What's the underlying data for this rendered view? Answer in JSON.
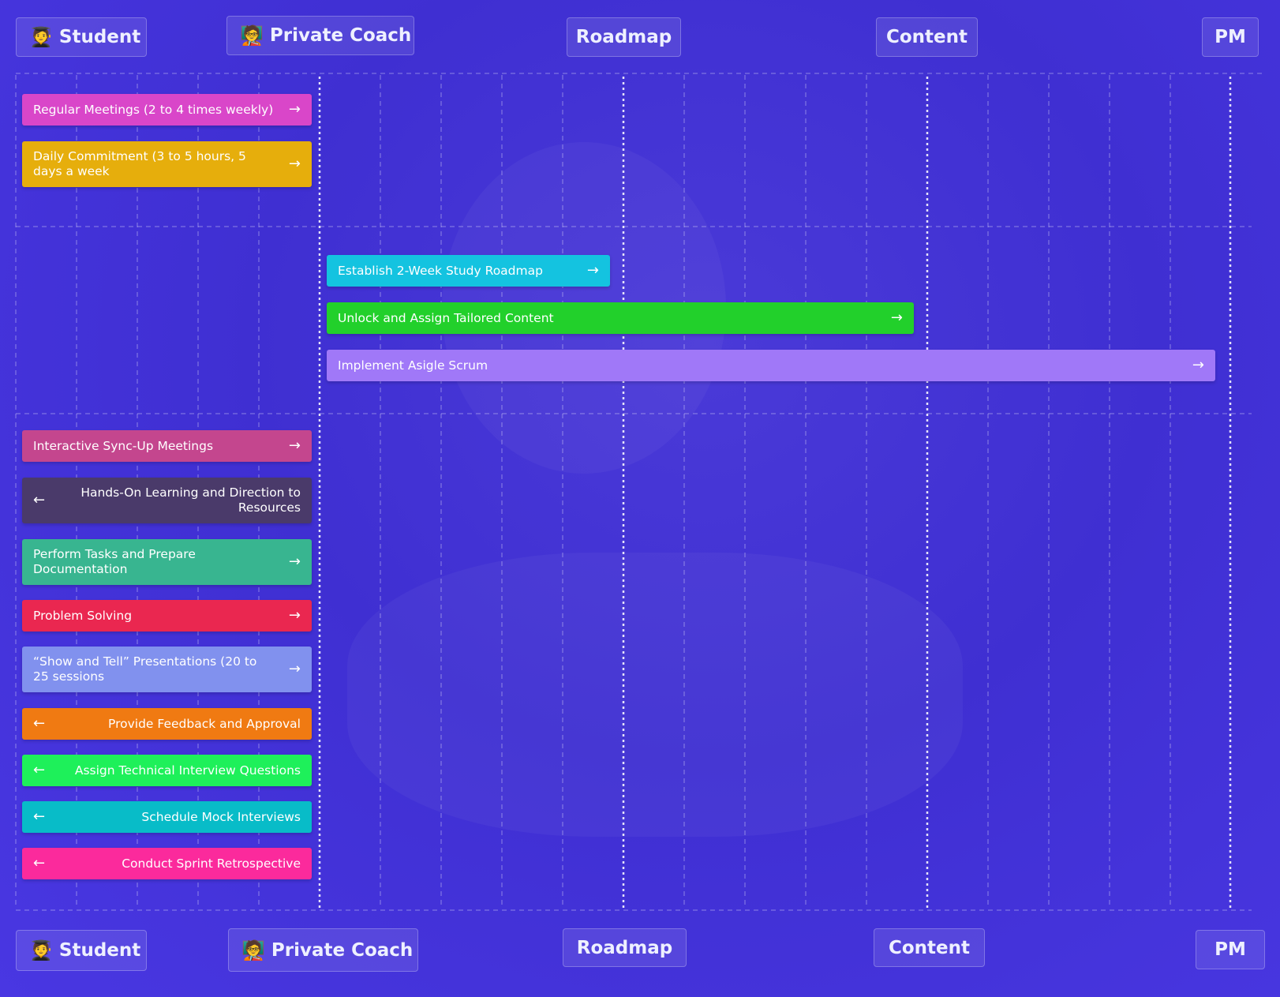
{
  "columns": {
    "student": "Student",
    "coach": "Private Coach",
    "roadmap": "Roadmap",
    "content": "Content",
    "pm": "PM"
  },
  "emojis": {
    "student": "🧑‍🎓",
    "coach": "🧑‍🏫"
  },
  "bars": {
    "regular_meetings": {
      "label": "Regular Meetings (2 to 4 times weekly)",
      "direction": "right",
      "color": "#d946c9"
    },
    "daily_commitment": {
      "label": "Daily Commitment (3 to 5 hours, 5 days a week",
      "direction": "right",
      "color": "#e6ae0c"
    },
    "establish_roadmap": {
      "label": "Establish 2-Week Study Roadmap",
      "direction": "right",
      "color": "#14c3e0"
    },
    "unlock_content": {
      "label": "Unlock and Assign Tailored Content",
      "direction": "right",
      "color": "#22d02b"
    },
    "implement_scrum": {
      "label": "Implement Asigle Scrum",
      "direction": "right",
      "color": "#a078f8"
    },
    "sync_meetings": {
      "label": "Interactive Sync-Up Meetings",
      "direction": "right",
      "color": "#c4468e"
    },
    "hands_on": {
      "label": "Hands-On Learning and Direction to Resources",
      "direction": "left",
      "color": "#4a3a6a"
    },
    "perform_tasks": {
      "label": "Perform Tasks and Prepare Documentation",
      "direction": "right",
      "color": "#38b590"
    },
    "problem_solving": {
      "label": "Problem Solving",
      "direction": "right",
      "color": "#ea2750"
    },
    "show_and_tell": {
      "label": "“Show and Tell” Presentations (20 to 25 sessions",
      "direction": "right",
      "color": "#8191ee"
    },
    "feedback": {
      "label": "Provide Feedback and Approval",
      "direction": "left",
      "color": "#f07a12"
    },
    "interview_questions": {
      "label": "Assign Technical Interview Questions",
      "direction": "left",
      "color": "#1ef05a"
    },
    "mock_interviews": {
      "label": "Schedule Mock Interviews",
      "direction": "left",
      "color": "#08bcc8"
    },
    "retrospective": {
      "label": "Conduct Sprint Retrospective",
      "direction": "left",
      "color": "#fb2a9c"
    }
  },
  "arrows": {
    "right": "→",
    "left": "←"
  }
}
